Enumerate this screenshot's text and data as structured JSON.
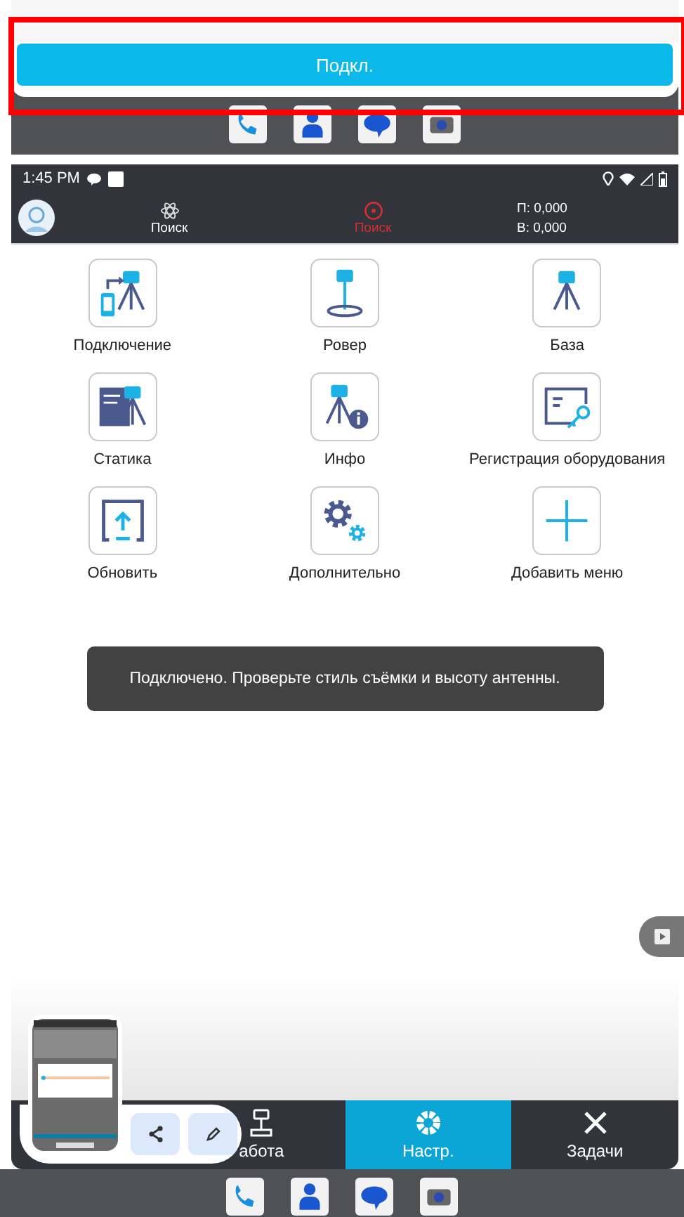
{
  "connect_sheet": {
    "button": "Подкл."
  },
  "status_bar": {
    "time": "1:45 PM"
  },
  "header": {
    "items": [
      {
        "label": "Поиск",
        "color": "#ffffff"
      },
      {
        "label": "Поиск",
        "color": "#d32f2f"
      }
    ],
    "coordinates": [
      "П: 0,000",
      "В: 0,000"
    ]
  },
  "menu": [
    {
      "label": "Подключение"
    },
    {
      "label": "Ровер"
    },
    {
      "label": "База"
    },
    {
      "label": "Статика"
    },
    {
      "label": "Инфо"
    },
    {
      "label": "Регистрация оборудования"
    },
    {
      "label": "Обновить"
    },
    {
      "label": "Дополнительно"
    },
    {
      "label": "Добавить меню"
    }
  ],
  "toast": "Подключено. Проверьте стиль съёмки и высоту антенны.",
  "bottom_nav": [
    {
      "label": "абота",
      "selected": false
    },
    {
      "label": "Настр.",
      "selected": true
    },
    {
      "label": "Задачи",
      "selected": false
    }
  ]
}
